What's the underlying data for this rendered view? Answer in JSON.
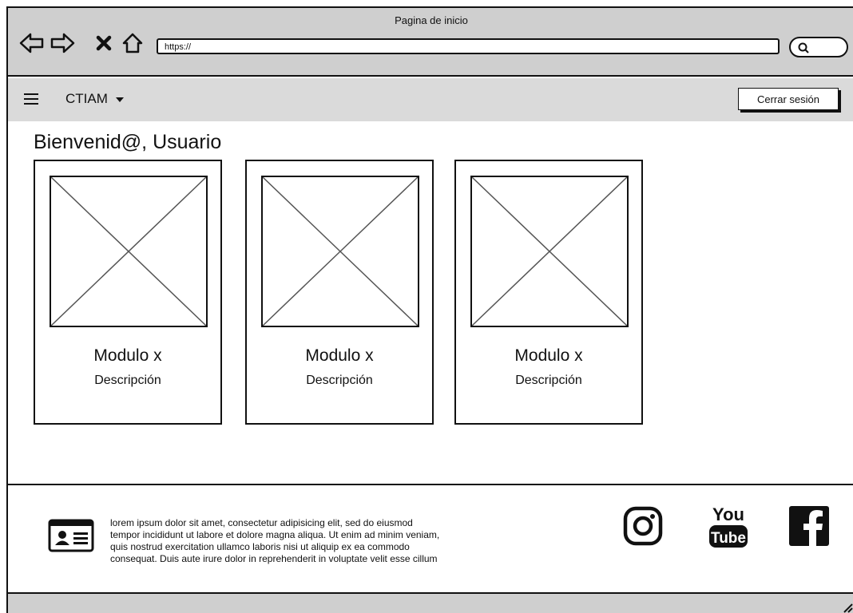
{
  "window": {
    "title": "Pagina de inicio"
  },
  "address_bar": {
    "url": "https://"
  },
  "appbar": {
    "brand": "CTIAM",
    "logout_label": "Cerrar sesión"
  },
  "main": {
    "welcome": "Bienvenid@, Usuario",
    "cards": [
      {
        "title": "Modulo x",
        "description": "Descripción"
      },
      {
        "title": "Modulo x",
        "description": "Descripción"
      },
      {
        "title": "Modulo x",
        "description": "Descripción"
      }
    ]
  },
  "footer": {
    "text_lines": [
      "lorem ipsum dolor sit amet, consectetur adipisicing elit, sed do eiusmod",
      "tempor incididunt ut labore et dolore magna aliqua. Ut enim ad minim veniam,",
      "quis nostrud exercitation ullamco laboris nisi ut aliquip ex ea commodo",
      "consequat. Duis aute irure dolor in reprehenderit in voluptate velit esse cillum"
    ],
    "social": {
      "youtube_top": "You",
      "youtube_bottom": "Tube"
    }
  },
  "icons": [
    "back-arrow-icon",
    "forward-arrow-icon",
    "stop-icon",
    "home-icon",
    "search-icon",
    "menu-icon",
    "id-card-icon",
    "instagram-icon",
    "youtube-icon",
    "facebook-icon",
    "resize-grip-icon"
  ]
}
